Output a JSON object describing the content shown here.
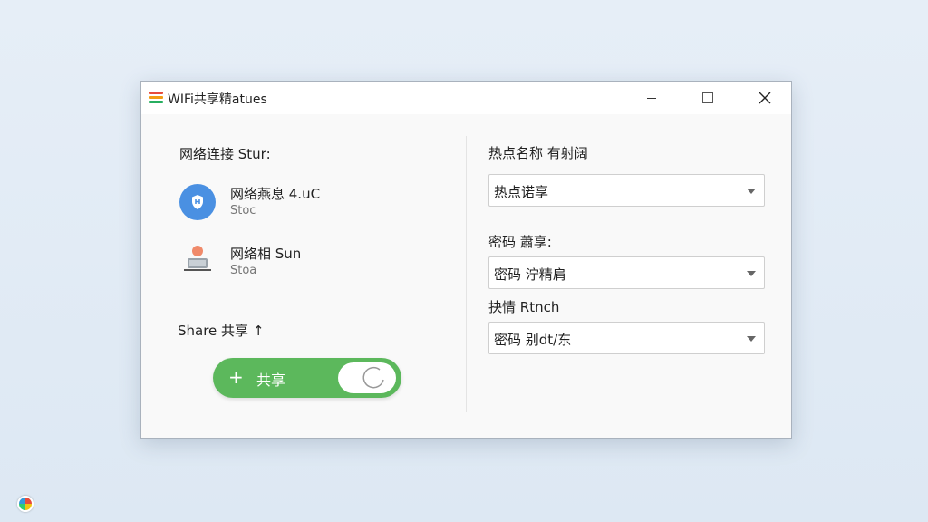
{
  "window": {
    "title": "WIFi共享精atues"
  },
  "network": {
    "section_title": "网络连接 Stur:",
    "items": [
      {
        "name": "网络燕息 4.uC",
        "status": "Stoc",
        "icon": "network-shield-icon"
      },
      {
        "name": "网络相 Sun",
        "status": "Stoa",
        "icon": "user-computer-icon"
      }
    ]
  },
  "share": {
    "title": "Share 共享 ↑",
    "plus": "+",
    "toggle_label": "共享"
  },
  "hotspot": {
    "name_label": "热点名称 有射阔",
    "name_value": "热点诺享",
    "password_label": "密码 蕭享:",
    "password_value": "密码 泞精肩",
    "encrypt_label": "抉情 Rtnch",
    "encrypt_value": "密码 别dt/东"
  },
  "colors": {
    "accent_green": "#5cb85c",
    "icon_blue": "#4a90e2"
  }
}
